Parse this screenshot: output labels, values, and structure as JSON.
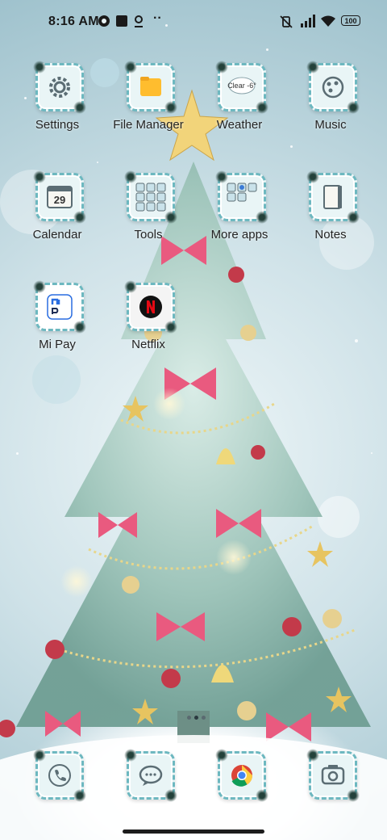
{
  "status_bar": {
    "time": "8:16 AM",
    "battery": "100"
  },
  "apps": [
    {
      "label": "Settings",
      "icon": "gear-icon"
    },
    {
      "label": "File Manager",
      "icon": "folder-icon"
    },
    {
      "label": "Weather",
      "icon": "cloud-icon",
      "badge": "Clear -6°"
    },
    {
      "label": "Music",
      "icon": "music-palette-icon"
    },
    {
      "label": "Calendar",
      "icon": "calendar-icon",
      "badge": "29"
    },
    {
      "label": "Tools",
      "icon": "tools-folder-icon"
    },
    {
      "label": "More apps",
      "icon": "more-apps-folder-icon"
    },
    {
      "label": "Notes",
      "icon": "notes-icon"
    },
    {
      "label": "Mi Pay",
      "icon": "mi-pay-icon"
    },
    {
      "label": "Netflix",
      "icon": "netflix-icon"
    }
  ],
  "dock": [
    {
      "icon": "phone-icon"
    },
    {
      "icon": "messages-icon"
    },
    {
      "icon": "chrome-icon"
    },
    {
      "icon": "camera-icon"
    }
  ],
  "colors": {
    "tile_border": "#6db8c0",
    "tile_bg": "#e9f5f6",
    "netflix_red": "#e50914",
    "folder_yellow": "#ffbd2e"
  }
}
